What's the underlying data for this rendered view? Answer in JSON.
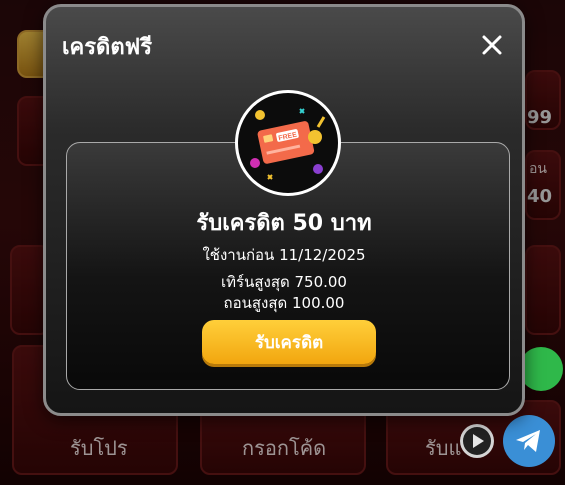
{
  "modal": {
    "title": "เครดิตฟรี",
    "credit_title": "รับเครดิต 50 บาท",
    "use_before": "ใช้งานก่อน 11/12/2025",
    "turnover": "เทิร์นสูงสุด 750.00",
    "withdraw": "ถอนสูงสุด 100.00",
    "claim_button": "รับเครดิต",
    "card_label": "FREE"
  },
  "background": {
    "tabs": [
      "รับโปร",
      "กรอกโค้ด",
      "รับแ"
    ],
    "side_numbers": [
      "99",
      "40"
    ],
    "side_labels": [
      "อน"
    ]
  },
  "colors": {
    "claim_button": "#f2a60f",
    "modal_bg": "#1b1b1b",
    "card": "#f36a4a"
  }
}
